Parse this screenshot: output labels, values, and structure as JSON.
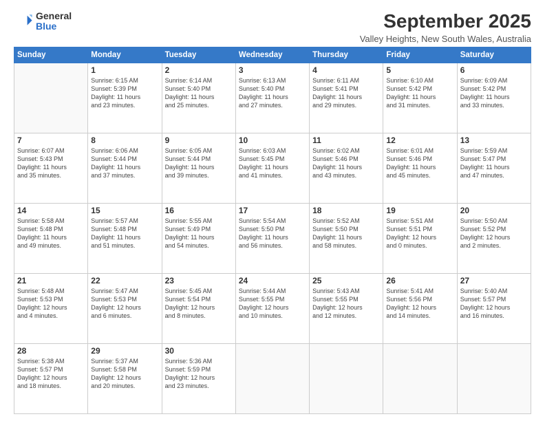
{
  "header": {
    "logo_general": "General",
    "logo_blue": "Blue",
    "title": "September 2025",
    "subtitle": "Valley Heights, New South Wales, Australia"
  },
  "days_of_week": [
    "Sunday",
    "Monday",
    "Tuesday",
    "Wednesday",
    "Thursday",
    "Friday",
    "Saturday"
  ],
  "weeks": [
    [
      {
        "day": "",
        "info": ""
      },
      {
        "day": "1",
        "info": "Sunrise: 6:15 AM\nSunset: 5:39 PM\nDaylight: 11 hours\nand 23 minutes."
      },
      {
        "day": "2",
        "info": "Sunrise: 6:14 AM\nSunset: 5:40 PM\nDaylight: 11 hours\nand 25 minutes."
      },
      {
        "day": "3",
        "info": "Sunrise: 6:13 AM\nSunset: 5:40 PM\nDaylight: 11 hours\nand 27 minutes."
      },
      {
        "day": "4",
        "info": "Sunrise: 6:11 AM\nSunset: 5:41 PM\nDaylight: 11 hours\nand 29 minutes."
      },
      {
        "day": "5",
        "info": "Sunrise: 6:10 AM\nSunset: 5:42 PM\nDaylight: 11 hours\nand 31 minutes."
      },
      {
        "day": "6",
        "info": "Sunrise: 6:09 AM\nSunset: 5:42 PM\nDaylight: 11 hours\nand 33 minutes."
      }
    ],
    [
      {
        "day": "7",
        "info": "Sunrise: 6:07 AM\nSunset: 5:43 PM\nDaylight: 11 hours\nand 35 minutes."
      },
      {
        "day": "8",
        "info": "Sunrise: 6:06 AM\nSunset: 5:44 PM\nDaylight: 11 hours\nand 37 minutes."
      },
      {
        "day": "9",
        "info": "Sunrise: 6:05 AM\nSunset: 5:44 PM\nDaylight: 11 hours\nand 39 minutes."
      },
      {
        "day": "10",
        "info": "Sunrise: 6:03 AM\nSunset: 5:45 PM\nDaylight: 11 hours\nand 41 minutes."
      },
      {
        "day": "11",
        "info": "Sunrise: 6:02 AM\nSunset: 5:46 PM\nDaylight: 11 hours\nand 43 minutes."
      },
      {
        "day": "12",
        "info": "Sunrise: 6:01 AM\nSunset: 5:46 PM\nDaylight: 11 hours\nand 45 minutes."
      },
      {
        "day": "13",
        "info": "Sunrise: 5:59 AM\nSunset: 5:47 PM\nDaylight: 11 hours\nand 47 minutes."
      }
    ],
    [
      {
        "day": "14",
        "info": "Sunrise: 5:58 AM\nSunset: 5:48 PM\nDaylight: 11 hours\nand 49 minutes."
      },
      {
        "day": "15",
        "info": "Sunrise: 5:57 AM\nSunset: 5:48 PM\nDaylight: 11 hours\nand 51 minutes."
      },
      {
        "day": "16",
        "info": "Sunrise: 5:55 AM\nSunset: 5:49 PM\nDaylight: 11 hours\nand 54 minutes."
      },
      {
        "day": "17",
        "info": "Sunrise: 5:54 AM\nSunset: 5:50 PM\nDaylight: 11 hours\nand 56 minutes."
      },
      {
        "day": "18",
        "info": "Sunrise: 5:52 AM\nSunset: 5:50 PM\nDaylight: 11 hours\nand 58 minutes."
      },
      {
        "day": "19",
        "info": "Sunrise: 5:51 AM\nSunset: 5:51 PM\nDaylight: 12 hours\nand 0 minutes."
      },
      {
        "day": "20",
        "info": "Sunrise: 5:50 AM\nSunset: 5:52 PM\nDaylight: 12 hours\nand 2 minutes."
      }
    ],
    [
      {
        "day": "21",
        "info": "Sunrise: 5:48 AM\nSunset: 5:53 PM\nDaylight: 12 hours\nand 4 minutes."
      },
      {
        "day": "22",
        "info": "Sunrise: 5:47 AM\nSunset: 5:53 PM\nDaylight: 12 hours\nand 6 minutes."
      },
      {
        "day": "23",
        "info": "Sunrise: 5:45 AM\nSunset: 5:54 PM\nDaylight: 12 hours\nand 8 minutes."
      },
      {
        "day": "24",
        "info": "Sunrise: 5:44 AM\nSunset: 5:55 PM\nDaylight: 12 hours\nand 10 minutes."
      },
      {
        "day": "25",
        "info": "Sunrise: 5:43 AM\nSunset: 5:55 PM\nDaylight: 12 hours\nand 12 minutes."
      },
      {
        "day": "26",
        "info": "Sunrise: 5:41 AM\nSunset: 5:56 PM\nDaylight: 12 hours\nand 14 minutes."
      },
      {
        "day": "27",
        "info": "Sunrise: 5:40 AM\nSunset: 5:57 PM\nDaylight: 12 hours\nand 16 minutes."
      }
    ],
    [
      {
        "day": "28",
        "info": "Sunrise: 5:38 AM\nSunset: 5:57 PM\nDaylight: 12 hours\nand 18 minutes."
      },
      {
        "day": "29",
        "info": "Sunrise: 5:37 AM\nSunset: 5:58 PM\nDaylight: 12 hours\nand 20 minutes."
      },
      {
        "day": "30",
        "info": "Sunrise: 5:36 AM\nSunset: 5:59 PM\nDaylight: 12 hours\nand 23 minutes."
      },
      {
        "day": "",
        "info": ""
      },
      {
        "day": "",
        "info": ""
      },
      {
        "day": "",
        "info": ""
      },
      {
        "day": "",
        "info": ""
      }
    ]
  ]
}
